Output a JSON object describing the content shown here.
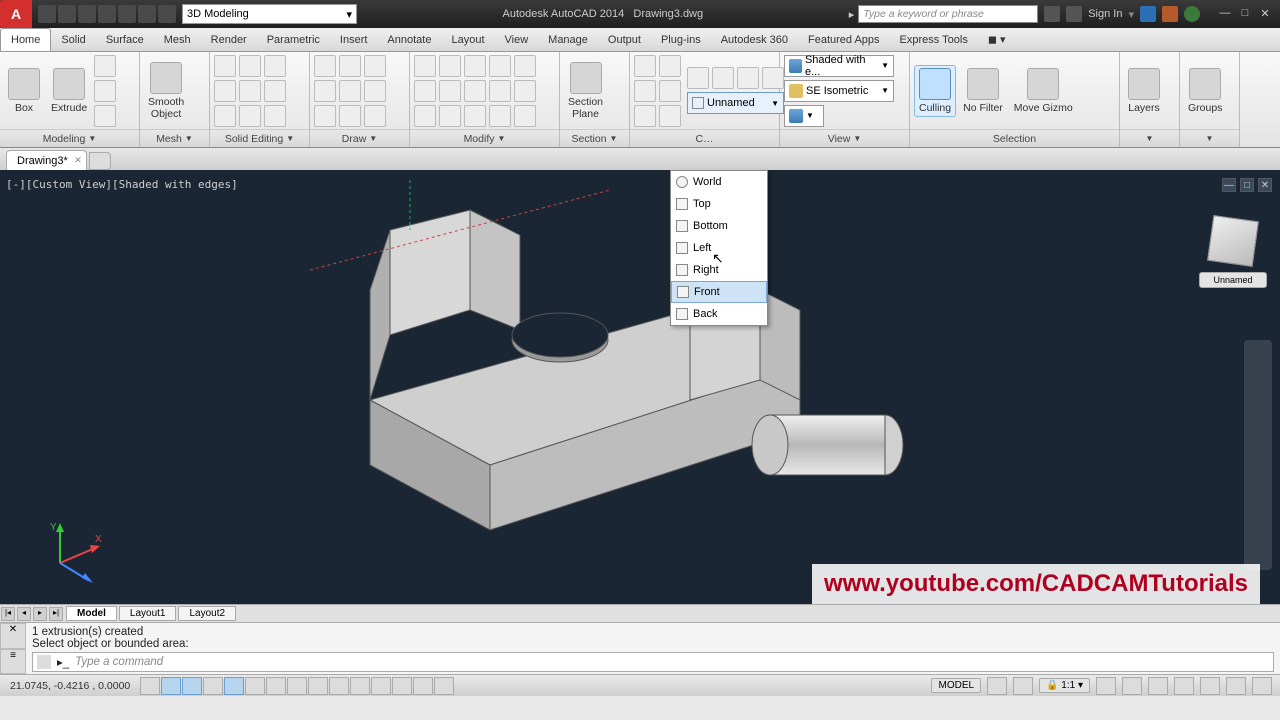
{
  "title": {
    "app": "Autodesk AutoCAD 2014",
    "doc": "Drawing3.dwg"
  },
  "qat": {
    "workspace": "3D Modeling"
  },
  "search": {
    "placeholder": "Type a keyword or phrase"
  },
  "signin": "Sign In",
  "tabs": [
    "Home",
    "Solid",
    "Surface",
    "Mesh",
    "Render",
    "Parametric",
    "Insert",
    "Annotate",
    "Layout",
    "View",
    "Manage",
    "Output",
    "Plug-ins",
    "Autodesk 360",
    "Featured Apps",
    "Express Tools"
  ],
  "active_tab": "Home",
  "panels": {
    "modeling": {
      "title": "Modeling",
      "box": "Box",
      "extrude": "Extrude"
    },
    "mesh": {
      "title": "Mesh",
      "smooth": "Smooth\nObject"
    },
    "solid_editing": {
      "title": "Solid Editing"
    },
    "draw": {
      "title": "Draw"
    },
    "modify": {
      "title": "Modify"
    },
    "section": {
      "title": "Section",
      "plane": "Section\nPlane"
    },
    "coords": {
      "ucs_dd": "Unnamed",
      "iso": "SE Isometric",
      "shaded": "Shaded with e..."
    },
    "view": {
      "title": "View"
    },
    "selection": {
      "title": "Selection",
      "culling": "Culling",
      "nofilter": "No Filter",
      "movegizmo": "Move Gizmo"
    },
    "layers": "Layers",
    "groups": "Groups"
  },
  "ucs_menu": {
    "items": [
      "World",
      "Top",
      "Bottom",
      "Left",
      "Right",
      "Front",
      "Back"
    ],
    "highlighted": "Front"
  },
  "filetab": "Drawing3*",
  "viewlabel": "[-][Custom View][Shaded with edges]",
  "viewcube_label": "Unnamed",
  "layout_tabs": [
    "Model",
    "Layout1",
    "Layout2"
  ],
  "cmd": {
    "line1": "1 extrusion(s) created",
    "line2": "Select object or bounded area:",
    "placeholder": "Type a command"
  },
  "status": {
    "coords": "21.0745, -0.4216 , 0.0000",
    "model": "MODEL",
    "scale": "1:1"
  },
  "watermark": "www.youtube.com/CADCAMTutorials"
}
